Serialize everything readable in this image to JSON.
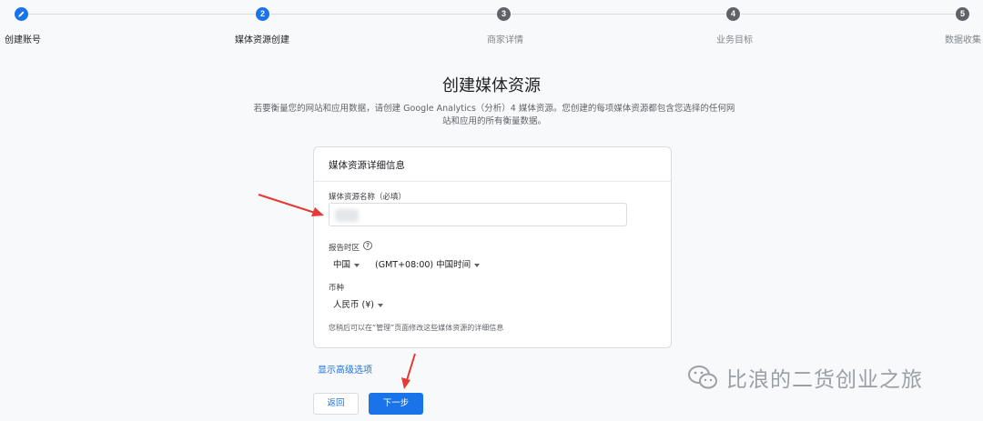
{
  "stepper": {
    "steps": [
      {
        "number": "",
        "label": "创建账号",
        "state": "done"
      },
      {
        "number": "2",
        "label": "媒体资源创建",
        "state": "current"
      },
      {
        "number": "3",
        "label": "商家详情",
        "state": "upcoming"
      },
      {
        "number": "4",
        "label": "业务目标",
        "state": "upcoming"
      },
      {
        "number": "5",
        "label": "数据收集",
        "state": "upcoming"
      }
    ]
  },
  "page": {
    "title": "创建媒体资源",
    "description": "若要衡量您的网站和应用数据，请创建 Google Analytics（分析）4 媒体资源。您创建的每项媒体资源都包含您选择的任何网站和应用的所有衡量数据。"
  },
  "card": {
    "header": "媒体资源详细信息",
    "property_name_label": "媒体资源名称（必填）",
    "property_name_value": "",
    "timezone_label": "报告时区",
    "country_value": "中国",
    "timezone_value": "(GMT+08:00) 中国时间",
    "currency_label": "币种",
    "currency_value": "人民币 (¥)",
    "note": "您稍后可以在“管理”页面修改这些媒体资源的详细信息"
  },
  "actions": {
    "advanced_link": "显示高级选项",
    "back_label": "返回",
    "next_label": "下一步"
  },
  "watermark": {
    "text": "比浪的二货创业之旅"
  },
  "colors": {
    "accent": "#1a73e8",
    "annotation_arrow": "#e53935",
    "inactive_step": "#5f6368"
  }
}
